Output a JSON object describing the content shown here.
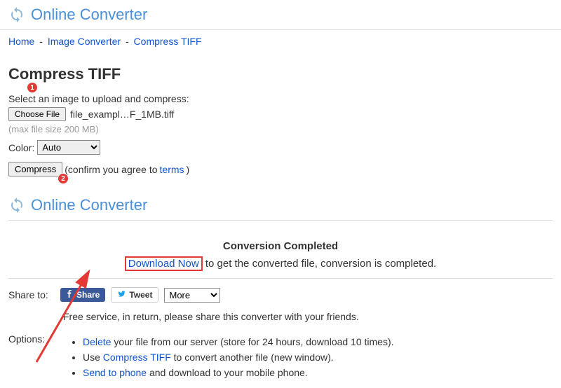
{
  "header": {
    "logo_text": "Online Converter"
  },
  "breadcrumb": {
    "home": "Home",
    "image_converter": "Image Converter",
    "compress_tiff": "Compress TIFF",
    "sep": "-"
  },
  "page": {
    "title": "Compress TIFF",
    "select_label": "Select an image to upload and compress:",
    "choose_file_label": "Choose File",
    "file_name": "file_exampl…F_1MB.tiff",
    "max_size_hint": "(max file size 200 MB)",
    "color_label": "Color:",
    "color_value": "Auto",
    "compress_label": "Compress",
    "confirm_prefix": "(confirm you agree to ",
    "terms_link": "terms",
    "confirm_suffix": ")"
  },
  "badges": {
    "b1": "1",
    "b2": "2"
  },
  "result": {
    "completed_title": "Conversion Completed",
    "download_link": "Download Now",
    "download_suffix": " to get the converted file, conversion is completed."
  },
  "share": {
    "label": "Share to:",
    "fb": "Share",
    "tw": "Tweet",
    "more": "More",
    "note": "Free service, in return, please share this converter with your friends."
  },
  "options": {
    "label": "Options:",
    "delete_link": "Delete",
    "delete_rest": " your file from our server (store for 24 hours, download 10 times).",
    "use_prefix": "Use ",
    "compress_link": "Compress TIFF",
    "use_rest": " to convert another file (new window).",
    "send_link": "Send to phone",
    "send_rest": " and download to your mobile phone."
  }
}
